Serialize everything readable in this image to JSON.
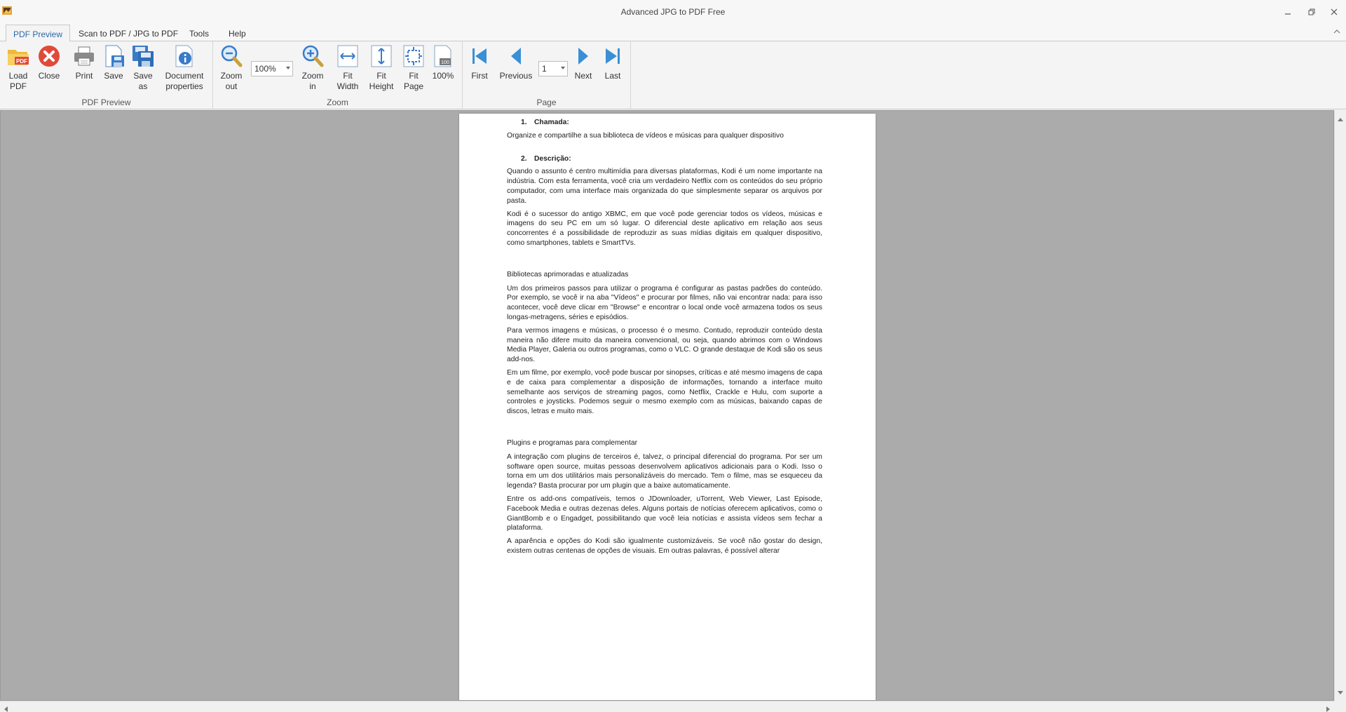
{
  "window": {
    "title": "Advanced JPG to PDF Free",
    "icon": "app-icon"
  },
  "tabs": [
    {
      "label": "PDF Preview",
      "active": true
    },
    {
      "label": "Scan to PDF / JPG to PDF",
      "active": false
    },
    {
      "label": "Tools",
      "active": false
    },
    {
      "label": "Help",
      "active": false
    }
  ],
  "ribbon": {
    "pdf_preview": {
      "group_label": "PDF Preview",
      "load_pdf": "Load\nPDF",
      "close": "Close",
      "print": "Print",
      "save": "Save",
      "save_as": "Save\nas",
      "document_properties": "Document\nproperties"
    },
    "zoom": {
      "group_label": "Zoom",
      "zoom_out": "Zoom\nout",
      "zoom_value": "100%",
      "zoom_in": "Zoom\nin",
      "fit_width": "Fit\nWidth",
      "fit_height": "Fit\nHeight",
      "fit_page": "Fit\nPage",
      "actual_size": "100%"
    },
    "page": {
      "group_label": "Page",
      "first": "First",
      "previous": "Previous",
      "page_value": "1",
      "next": "Next",
      "last": "Last"
    }
  },
  "document": {
    "heading1": {
      "num": "1.",
      "text": "Chamada:"
    },
    "heading1_body": "Organize e compartilhe a sua biblioteca de vídeos e músicas para qualquer dispositivo",
    "heading2": {
      "num": "2.",
      "text": "Descrição:"
    },
    "p1": "Quando o assunto é centro multimídia para diversas plataformas, Kodi é um nome importante na indústria. Com esta ferramenta, você cria um verdadeiro Netflix com os conteúdos do seu próprio computador, com uma interface mais organizada do que simplesmente separar os arquivos por pasta.",
    "p2": "Kodi é o sucessor do antigo XBMC, em que você pode gerenciar todos os vídeos, músicas e imagens do seu PC em um só lugar. O diferencial deste aplicativo em relação aos seus concorrentes é a possibilidade de reproduzir as suas mídias digitais em qualquer dispositivo, como smartphones, tablets e SmartTVs.",
    "sub1": "Bibliotecas aprimoradas e atualizadas",
    "p3": "Um dos primeiros passos para utilizar o programa é configurar as pastas padrões do conteúdo. Por exemplo, se você ir na aba \"Vídeos\" e procurar por filmes, não vai encontrar nada: para isso acontecer, você deve clicar em \"Browse\" e encontrar o local onde você armazena todos os seus longas-metragens, séries e episódios.",
    "p4": "Para vermos imagens e músicas, o processo é o mesmo. Contudo, reproduzir conteúdo desta maneira não difere muito da maneira convencional, ou seja, quando abrimos com o Windows Media Player, Galeria ou outros programas, como o VLC. O grande destaque de Kodi são os seus add-nos.",
    "p5": "Em um filme, por exemplo, você pode buscar por sinopses, críticas e até mesmo imagens de capa e de caixa para complementar a disposição de informações, tornando a interface muito semelhante aos serviços de streaming pagos, como Netflix, Crackle e Hulu, com suporte a controles e joysticks. Podemos seguir o mesmo exemplo com as músicas, baixando capas de discos, letras e muito mais.",
    "sub2": "Plugins e programas para complementar",
    "p6": "A integração com plugins de terceiros é, talvez, o principal diferencial do programa. Por ser um software open source, muitas pessoas desenvolvem aplicativos adicionais para o Kodi. Isso o torna em um dos utilitários mais personalizáveis do mercado. Tem o filme, mas se esqueceu da legenda? Basta procurar por um plugin que a baixe automaticamente.",
    "p7": "Entre os add-ons compatíveis, temos o JDownloader, uTorrent, Web Viewer, Last Episode, Facebook Media e outras dezenas deles. Alguns portais de notícias oferecem aplicativos, como o GiantBomb e o Engadget, possibilitando que você leia notícias e assista vídeos sem fechar a plataforma.",
    "p8": "A aparência e opções do Kodi são igualmente customizáveis. Se você não gostar do design, existem outras centenas de opções de visuais. Em outras palavras, é possível alterar"
  },
  "colors": {
    "viewer_bg": "#ababab",
    "accent": "#2c6aa8",
    "nav_blue": "#3a8fd6",
    "close_red": "#e04a3a"
  }
}
